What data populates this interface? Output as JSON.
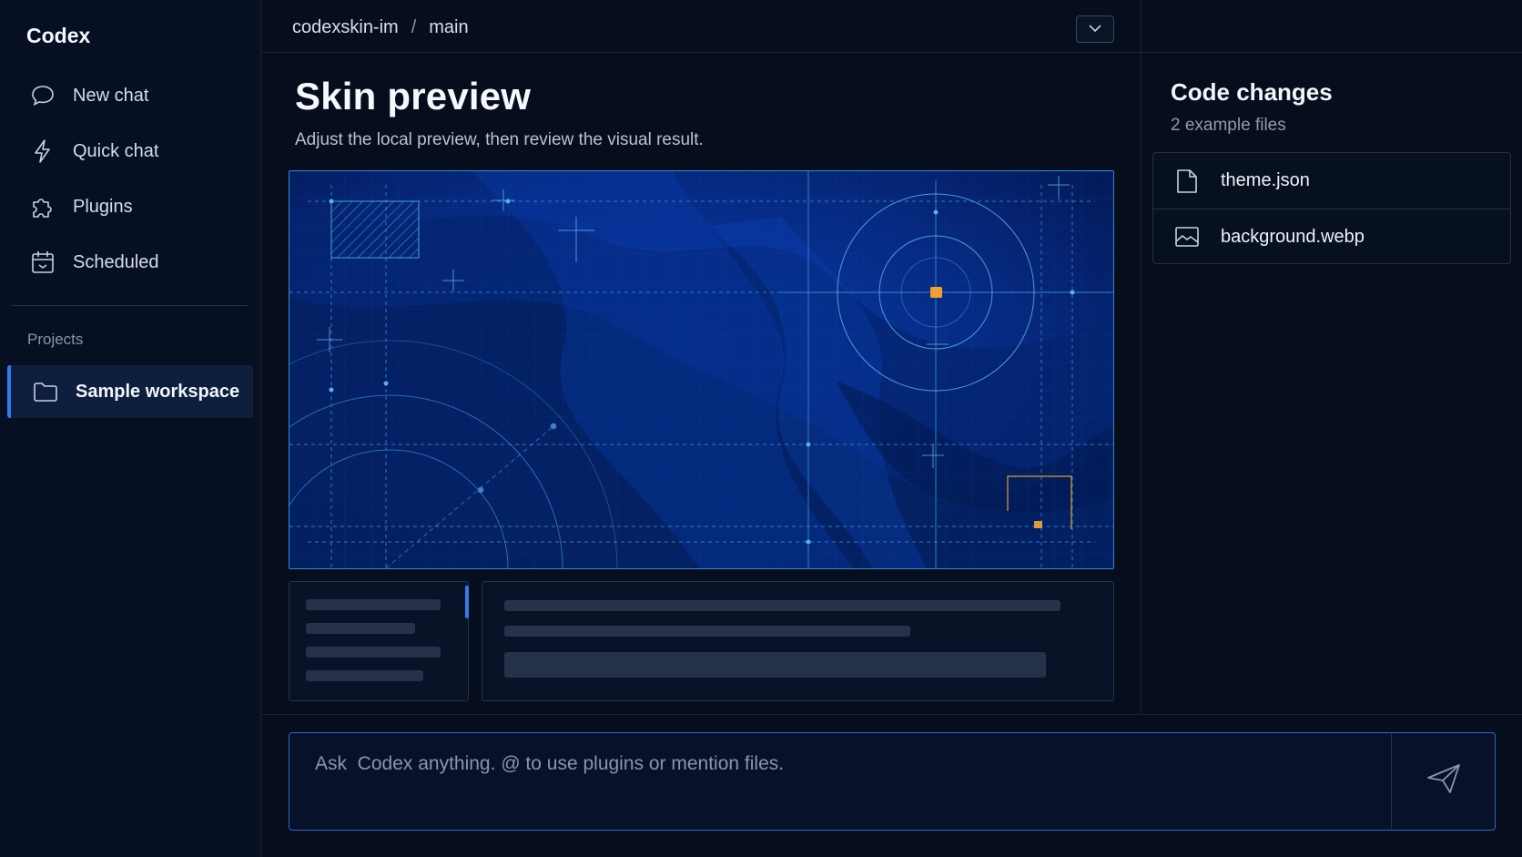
{
  "app": {
    "title": "Codex"
  },
  "sidebar": {
    "items": [
      {
        "label": "New chat",
        "icon": "chat-bubble-icon"
      },
      {
        "label": "Quick chat",
        "icon": "lightning-icon"
      },
      {
        "label": "Plugins",
        "icon": "puzzle-icon"
      },
      {
        "label": "Scheduled",
        "icon": "calendar-icon"
      }
    ],
    "projects_label": "Projects",
    "projects": [
      {
        "label": "Sample workspace",
        "icon": "folder-icon",
        "selected": true
      }
    ]
  },
  "header": {
    "repo": "codexskin-im",
    "separator": "/",
    "branch": "main",
    "dropdown_icon": "chevron-down-icon"
  },
  "main": {
    "title": "Skin preview",
    "subtitle": "Adjust the local preview, then review the visual result."
  },
  "changes": {
    "title": "Code changes",
    "subtitle": "2 example files",
    "files": [
      {
        "name": "theme.json",
        "icon": "file-icon"
      },
      {
        "name": "background.webp",
        "icon": "image-icon"
      }
    ]
  },
  "composer": {
    "placeholder": "Ask  Codex anything. @ to use plugins or mention files.",
    "send_icon": "send-icon"
  },
  "colors": {
    "background": "#060d1c",
    "accent": "#2f7bf0",
    "preview_blue": "#05206a",
    "highlight_orange": "#f0a030"
  }
}
